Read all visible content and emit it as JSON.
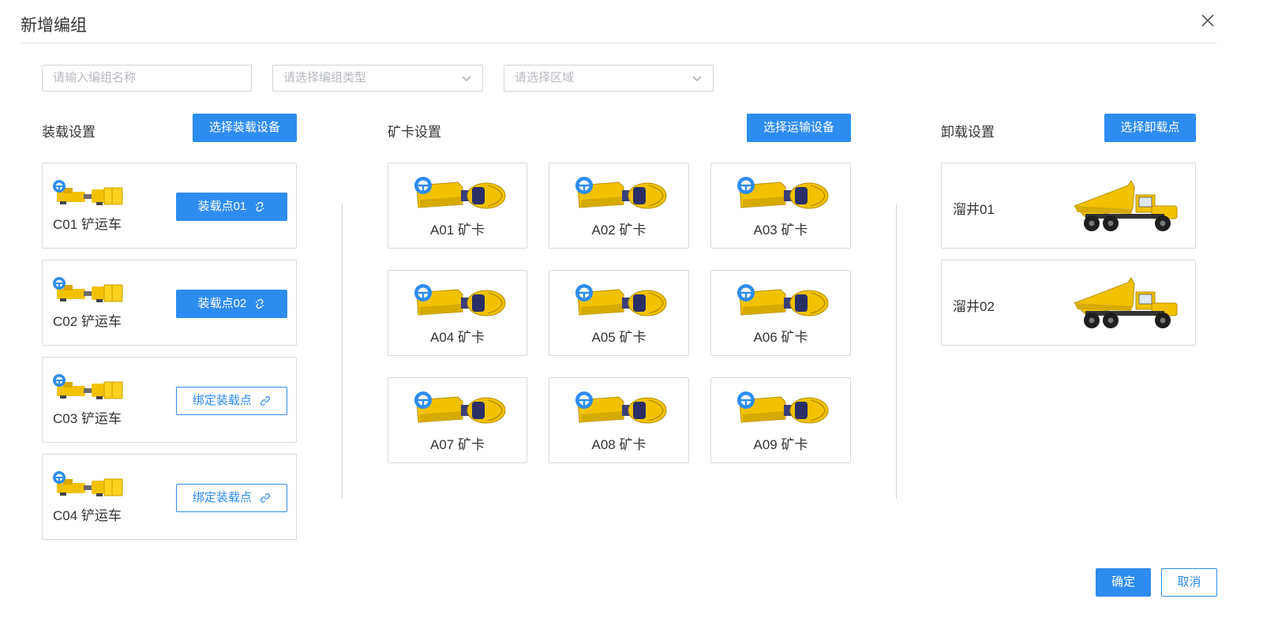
{
  "dialog": {
    "title": "新增编组"
  },
  "filters": {
    "name_placeholder": "请输入编组名称",
    "type_placeholder": "请选择编组类型",
    "area_placeholder": "请选择区域"
  },
  "loading": {
    "title": "装载设置",
    "select_button": "选择装载设备",
    "items": [
      {
        "name": "C01 铲运车",
        "action": "装载点01",
        "bound": true
      },
      {
        "name": "C02 铲运车",
        "action": "装载点02",
        "bound": true
      },
      {
        "name": "C03 铲运车",
        "action": "绑定装载点",
        "bound": false
      },
      {
        "name": "C04 铲运车",
        "action": "绑定装载点",
        "bound": false
      }
    ]
  },
  "trucks": {
    "title": "矿卡设置",
    "select_button": "选择运输设备",
    "items": [
      {
        "name": "A01 矿卡"
      },
      {
        "name": "A02 矿卡"
      },
      {
        "name": "A03 矿卡"
      },
      {
        "name": "A04 矿卡"
      },
      {
        "name": "A05 矿卡"
      },
      {
        "name": "A06 矿卡"
      },
      {
        "name": "A07 矿卡"
      },
      {
        "name": "A08 矿卡"
      },
      {
        "name": "A09 矿卡"
      }
    ]
  },
  "unloading": {
    "title": "卸载设置",
    "select_button": "选择卸载点",
    "items": [
      {
        "name": "溜井01"
      },
      {
        "name": "溜井02"
      }
    ]
  },
  "footer": {
    "confirm": "确定",
    "cancel": "取消"
  },
  "colors": {
    "primary": "#2d8cf0",
    "vehicle_yellow": "#f2c200",
    "border": "#d9d9d9"
  },
  "icons": {
    "close": "close-icon",
    "dropdown": "chevron-down-icon",
    "bound": "unlink-icon",
    "unbound": "link-icon",
    "driver": "steering-wheel-icon"
  }
}
